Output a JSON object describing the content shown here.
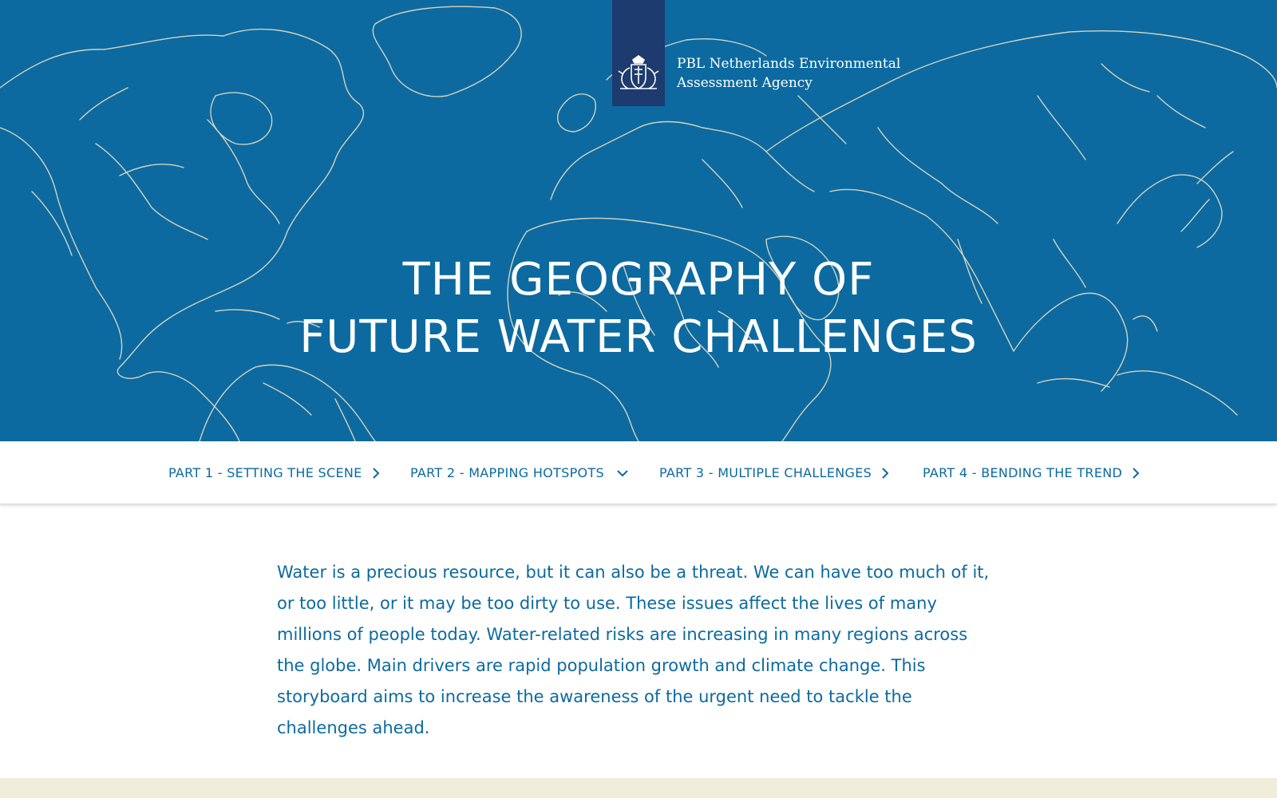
{
  "colors": {
    "hero_background": "#0c6aa0",
    "map_lines": "#e9dfc2",
    "logo_block": "#1d3b6e",
    "nav_text": "#0c6aa0",
    "body_text": "#0c6aa0",
    "footer_band": "#f0edda"
  },
  "header": {
    "logo_icon": "coat-of-arms-icon",
    "org_name_line1": "PBL Netherlands Environmental",
    "org_name_line2": "Assessment Agency"
  },
  "hero": {
    "title_line1": "THE GEOGRAPHY OF",
    "title_line2": "FUTURE WATER CHALLENGES",
    "background": "world-river-map"
  },
  "nav": {
    "items": [
      {
        "label": "PART 1 - SETTING THE SCENE",
        "icon": "chevron-right-icon"
      },
      {
        "label": "PART 2 - MAPPING HOTSPOTS",
        "icon": "chevron-down-icon"
      },
      {
        "label": "PART 3 - MULTIPLE CHALLENGES",
        "icon": "chevron-right-icon"
      },
      {
        "label": "PART 4 - BENDING THE TREND",
        "icon": "chevron-right-icon"
      }
    ]
  },
  "intro": {
    "text": "Water is a precious resource, but it can also be a threat. We can have too much of it, or too little, or it may be too dirty to use. These issues affect the lives of many millions of people today. Water-related risks are increasing in many regions across the globe. Main drivers are rapid population growth and climate change. This storyboard aims to increase the awareness of the urgent need to tackle the challenges ahead."
  }
}
